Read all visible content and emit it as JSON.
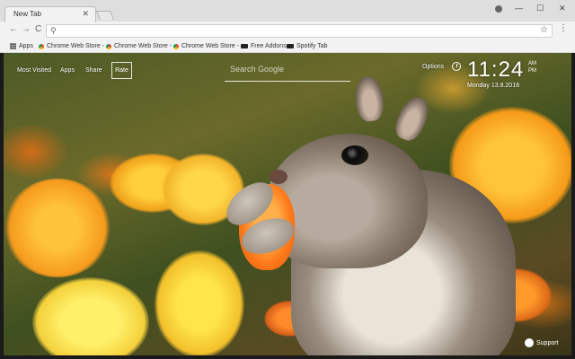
{
  "window": {
    "tab_title": "New Tab",
    "tab_close": "✕",
    "controls": {
      "minimize": "—",
      "maximize": "☐",
      "close": "✕"
    }
  },
  "toolbar": {
    "back": "←",
    "forward": "→",
    "reload": "C",
    "search_glyph": "⚲",
    "star_glyph": "☆",
    "menu_glyph": "⋮"
  },
  "bookmarks": [
    {
      "label": "Apps",
      "icon": "apps-icon"
    },
    {
      "label": "Chrome Web Store -",
      "icon": "chrome-web-store-icon"
    },
    {
      "label": "Chrome Web Store -",
      "icon": "chrome-web-store-icon"
    },
    {
      "label": "Chrome Web Store -",
      "icon": "chrome-web-store-icon"
    },
    {
      "label": "Free Addons",
      "icon": "addons-icon"
    },
    {
      "label": "Spotify Tab",
      "icon": "spotify-icon"
    }
  ],
  "newtab": {
    "links": [
      "Most Visited",
      "Apps",
      "Share"
    ],
    "rate": "Rate",
    "search_placeholder": "Search Google",
    "options": "Options",
    "time": "11:24",
    "ampm_top": "AM",
    "ampm_bottom": "PM",
    "date": "Monday  13.8.2018",
    "support": "Support"
  }
}
